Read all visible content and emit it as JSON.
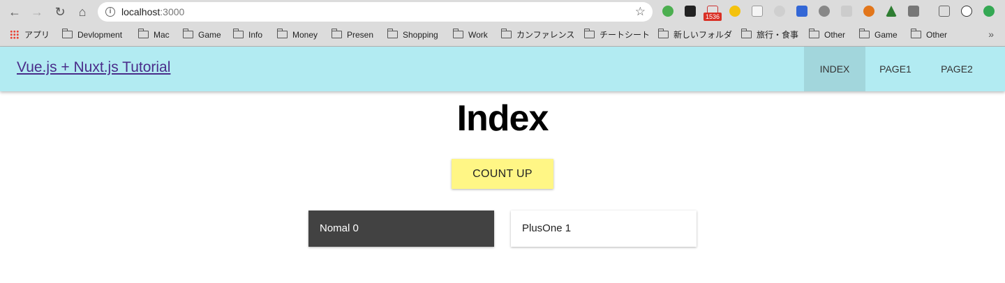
{
  "browser": {
    "url_host": "localhost",
    "url_port": ":3000",
    "gmail_badge": "1536",
    "bookmarks": [
      {
        "label": "アプリ",
        "icon": "apps-grid-icon"
      },
      {
        "label": "Devlopment",
        "icon": "folder-icon"
      },
      {
        "label": "Mac",
        "icon": "folder-icon"
      },
      {
        "label": "Game",
        "icon": "folder-icon"
      },
      {
        "label": "Info",
        "icon": "folder-icon"
      },
      {
        "label": "Money",
        "icon": "folder-icon"
      },
      {
        "label": "Presen",
        "icon": "folder-icon"
      },
      {
        "label": "Shopping",
        "icon": "folder-icon"
      },
      {
        "label": "Work",
        "icon": "folder-icon"
      },
      {
        "label": "カンファレンス",
        "icon": "folder-icon"
      },
      {
        "label": "チートシート",
        "icon": "folder-icon"
      },
      {
        "label": "新しいフォルダ",
        "icon": "folder-icon"
      },
      {
        "label": "旅行・食事",
        "icon": "folder-icon"
      },
      {
        "label": "Other",
        "icon": "folder-icon"
      },
      {
        "label": "Game",
        "icon": "folder-icon"
      },
      {
        "label": "Other",
        "icon": "folder-icon"
      }
    ],
    "overflow": "»"
  },
  "app": {
    "title": "Vue.js + Nuxt.js Tutorial",
    "nav": [
      {
        "label": "INDEX",
        "active": true
      },
      {
        "label": "PAGE1",
        "active": false
      },
      {
        "label": "PAGE2",
        "active": false
      }
    ],
    "colors": {
      "header": "#b2ebf2",
      "active_tab": "#a2d6dc",
      "button": "#fff685",
      "dark_card": "#424242"
    }
  },
  "page": {
    "heading": "Index",
    "count_button": "COUNT UP",
    "cards": [
      {
        "text": "Nomal 0"
      },
      {
        "text": "PlusOne 1"
      }
    ]
  }
}
